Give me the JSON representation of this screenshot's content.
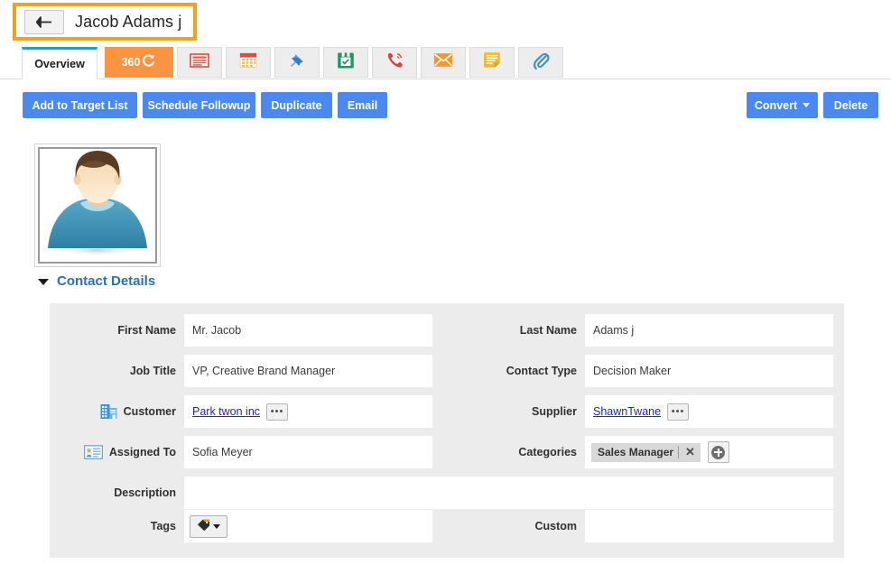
{
  "window": {
    "back_icon": "arrow-left-icon",
    "record_title": "Jacob Adams j"
  },
  "tabs": [
    {
      "label": "Overview",
      "icon": "",
      "state": "active",
      "type": "text"
    },
    {
      "label": "360",
      "icon": "refresh-circle-icon",
      "state": "highlight",
      "type": "text-icon"
    },
    {
      "label": "",
      "icon": "news-list-icon",
      "state": "normal",
      "type": "icon"
    },
    {
      "label": "",
      "icon": "calendar-icon",
      "state": "normal",
      "type": "icon"
    },
    {
      "label": "",
      "icon": "pin-icon",
      "state": "normal",
      "type": "icon"
    },
    {
      "label": "",
      "icon": "task-checklist-icon",
      "state": "normal",
      "type": "icon"
    },
    {
      "label": "",
      "icon": "phone-call-icon",
      "state": "normal",
      "type": "icon"
    },
    {
      "label": "",
      "icon": "envelope-icon",
      "state": "normal",
      "type": "icon"
    },
    {
      "label": "",
      "icon": "note-icon",
      "state": "normal",
      "type": "icon"
    },
    {
      "label": "",
      "icon": "paperclip-icon",
      "state": "normal",
      "type": "icon"
    }
  ],
  "toolbar": {
    "left_buttons": [
      {
        "label": "Add to Target List"
      },
      {
        "label": "Schedule Followup"
      },
      {
        "label": "Duplicate"
      },
      {
        "label": "Email"
      }
    ],
    "right_buttons": [
      {
        "label": "Convert",
        "has_caret": true
      },
      {
        "label": "Delete",
        "has_caret": false
      }
    ]
  },
  "avatar": {
    "icon": "default-user-avatar-icon"
  },
  "section": {
    "title": "Contact Details",
    "chevron": "chevron-down-icon"
  },
  "form": {
    "fields": {
      "first_name": {
        "label": "First Name",
        "value": "Mr. Jacob"
      },
      "last_name": {
        "label": "Last Name",
        "value": "Adams j"
      },
      "job_title": {
        "label": "Job Title",
        "value": "VP, Creative Brand Manager"
      },
      "contact_type": {
        "label": "Contact Type",
        "value": "Decision Maker"
      },
      "customer": {
        "label": "Customer",
        "value": "Park twon inc",
        "icon": "building-icon",
        "more_button": "•••"
      },
      "supplier": {
        "label": "Supplier",
        "value": "ShawnTwane",
        "more_button": "•••"
      },
      "assigned_to": {
        "label": "Assigned To",
        "value": "Sofia Meyer",
        "icon": "contact-card-icon"
      },
      "categories": {
        "label": "Categories",
        "chip": "Sales Manager",
        "remove": "✕",
        "add_icon": "plus-icon"
      },
      "description": {
        "label": "Description",
        "value": ""
      },
      "tags": {
        "label": "Tags",
        "value": "",
        "icon": "tag-icon"
      },
      "custom": {
        "label": "Custom",
        "value": ""
      }
    }
  },
  "colors": {
    "accent_blue": "#4a89f2",
    "tab_orange": "#fb9441",
    "highlight_border": "#f3a01d",
    "active_tab_top": "#2196f3",
    "link_blue": "#2020dd",
    "section_title": "#2a6ebb",
    "panel_bg": "#ececec"
  }
}
